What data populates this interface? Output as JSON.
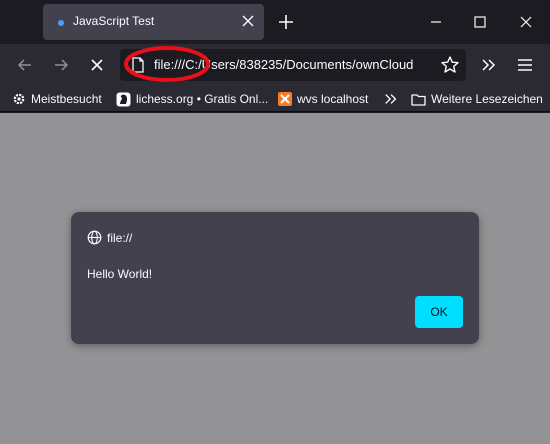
{
  "tab": {
    "title": "JavaScript Test"
  },
  "urlbar": {
    "url": "file:///C:/Users/838235/Documents/ownCloud"
  },
  "bookmarks": [
    {
      "label": "Meistbesucht",
      "icon": "gear-icon"
    },
    {
      "label": "lichess.org • Gratis Onl...",
      "icon": "lichess-icon"
    },
    {
      "label": "wvs localhost",
      "icon": "xampp-icon"
    },
    {
      "label": "Weitere Lesezeichen",
      "icon": "folder-icon"
    }
  ],
  "dialog": {
    "origin": "file://",
    "message": "Hello World!",
    "ok_label": "OK"
  },
  "colors": {
    "chrome_dark": "#1c1b22",
    "toolbar": "#2b2a33",
    "dialog_bg": "#42414d",
    "accent": "#00ddff",
    "content_overlay": "#939395",
    "annotation_red": "#e8101a"
  }
}
